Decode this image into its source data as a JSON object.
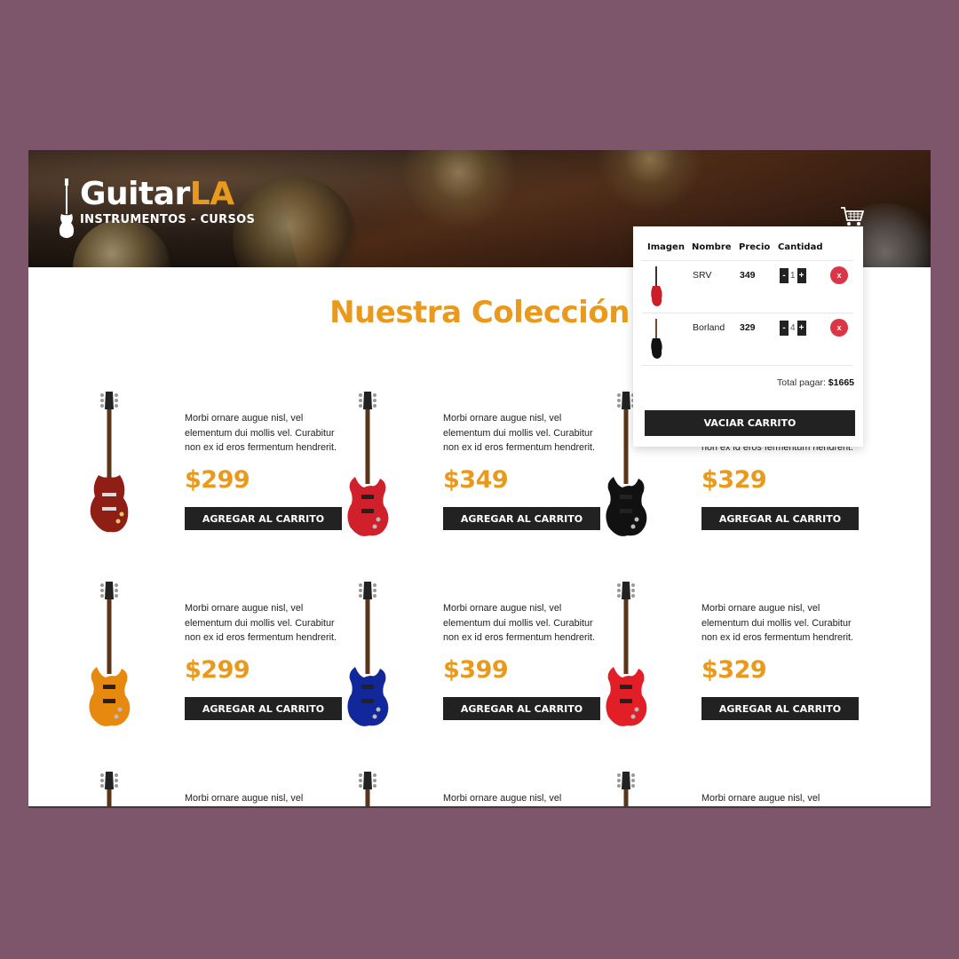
{
  "brand": {
    "name_main": "Guitar",
    "name_accent": "LA",
    "tagline": "INSTRUMENTOS - CURSOS",
    "accent_color": "#e99a1c"
  },
  "header": {
    "cart_icon": "cart-icon"
  },
  "cart": {
    "columns": [
      "Imagen",
      "Nombre",
      "Precio",
      "Cantidad"
    ],
    "items": [
      {
        "name": "SRV",
        "price": "349",
        "quantity": "1",
        "decrement": "-",
        "increment": "+",
        "remove": "x",
        "guitar_color": "#c81f2a"
      },
      {
        "name": "Borland",
        "price": "329",
        "quantity": "4",
        "decrement": "-",
        "increment": "+",
        "remove": "x",
        "guitar_color": "#111111"
      }
    ],
    "total_label": "Total pagar:",
    "total_value": "$1665",
    "empty_button": "VACIAR CARRITO"
  },
  "main": {
    "title": "Nuestra Colección",
    "add_button_label": "AGREGAR AL CARRITO",
    "description": "Morbi ornare augue nisl, vel elementum dui mollis vel. Curabitur non ex id eros fermentum hendrerit.",
    "products": [
      {
        "price": "$299",
        "body_color": "#8f1f14",
        "shape": "lp"
      },
      {
        "price": "$349",
        "body_color": "#d0202c",
        "shape": "strat"
      },
      {
        "price": "$329",
        "body_color": "#111111",
        "shape": "strat"
      },
      {
        "price": "$299",
        "body_color": "#e8890f",
        "shape": "strat"
      },
      {
        "price": "$399",
        "body_color": "#12279a",
        "shape": "strat"
      },
      {
        "price": "$329",
        "body_color": "#e21f27",
        "shape": "strat"
      }
    ],
    "partial_row_description": "Morbi ornare augue nisl, vel elementum dui mollis vel. Curabitur"
  }
}
